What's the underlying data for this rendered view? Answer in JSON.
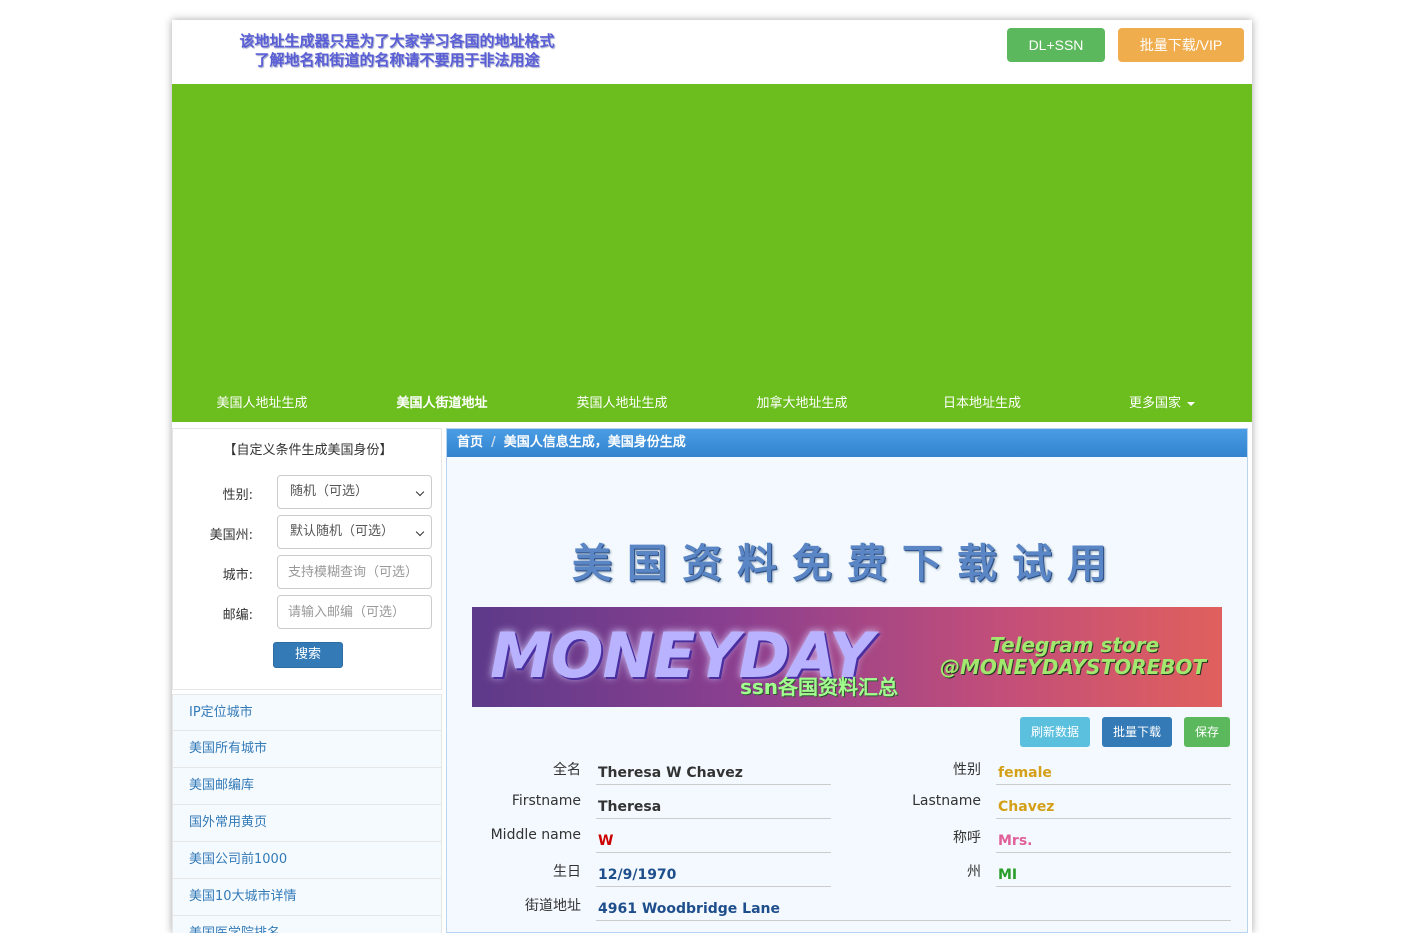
{
  "header": {
    "slogan_line1": "该地址生成器只是为了大家学习各国的地址格式",
    "slogan_line2": "了解地名和街道的名称请不要用于非法用途",
    "btn_dl_ssn": "DL+SSN",
    "btn_bulk_vip": "批量下载/VIP"
  },
  "nav": {
    "items": [
      "美国人地址生成",
      "美国人街道地址",
      "英国人地址生成",
      "加拿大地址生成",
      "日本地址生成",
      "更多国家"
    ]
  },
  "sidebar": {
    "form_title": "【自定义条件生成美国身份】",
    "gender_label": "性别:",
    "gender_value": "随机（可选）",
    "state_label": "美国州:",
    "state_value": "默认随机（可选）",
    "city_label": "城市:",
    "city_placeholder": "支持模糊查询（可选）",
    "zip_label": "邮编:",
    "zip_placeholder": "请输入邮编（可选）",
    "search_button": "搜索",
    "links": [
      "IP定位城市",
      "美国所有城市",
      "美国邮编库",
      "国外常用黄页",
      "美国公司前1000",
      "美国10大城市详情",
      "美国医学院排名"
    ]
  },
  "main": {
    "breadcrumb_home": "首页",
    "breadcrumb_sep": "/",
    "breadcrumb_current": "美国人信息生成，美国身份生成",
    "promo_title": "美国资料免费下载试用",
    "promo_logo": "MONEYDAY",
    "promo_sub": "ssn各国资料汇总",
    "promo_tg1": "Telegram store",
    "promo_tg2": "@MONEYDAYSTOREBOT",
    "btn_refresh": "刷新数据",
    "btn_batch": "批量下载",
    "btn_save": "保存",
    "fields": {
      "fullname_label": "全名",
      "fullname_value": "Theresa W Chavez",
      "gender_label": "性别",
      "gender_value": "female",
      "firstname_label": "Firstname",
      "firstname_value": "Theresa",
      "lastname_label": "Lastname",
      "lastname_value": "Chavez",
      "middle_label": "Middle name",
      "middle_value": "W",
      "title_label": "称呼",
      "title_value": "Mrs.",
      "birthday_label": "生日",
      "birthday_value": "12/9/1970",
      "state_label": "州",
      "state_value": "MI",
      "street_label": "街道地址",
      "street_value": "4961 Woodbridge Lane"
    }
  },
  "colors": {
    "banner_green": "#6cbe1f",
    "primary_blue": "#337ab7",
    "gender_value": "#d4a017",
    "middle_value": "#cc0000",
    "title_value": "#e0609a",
    "state_value": "#2a9d2a",
    "birthday_value": "#1f4e8c"
  }
}
